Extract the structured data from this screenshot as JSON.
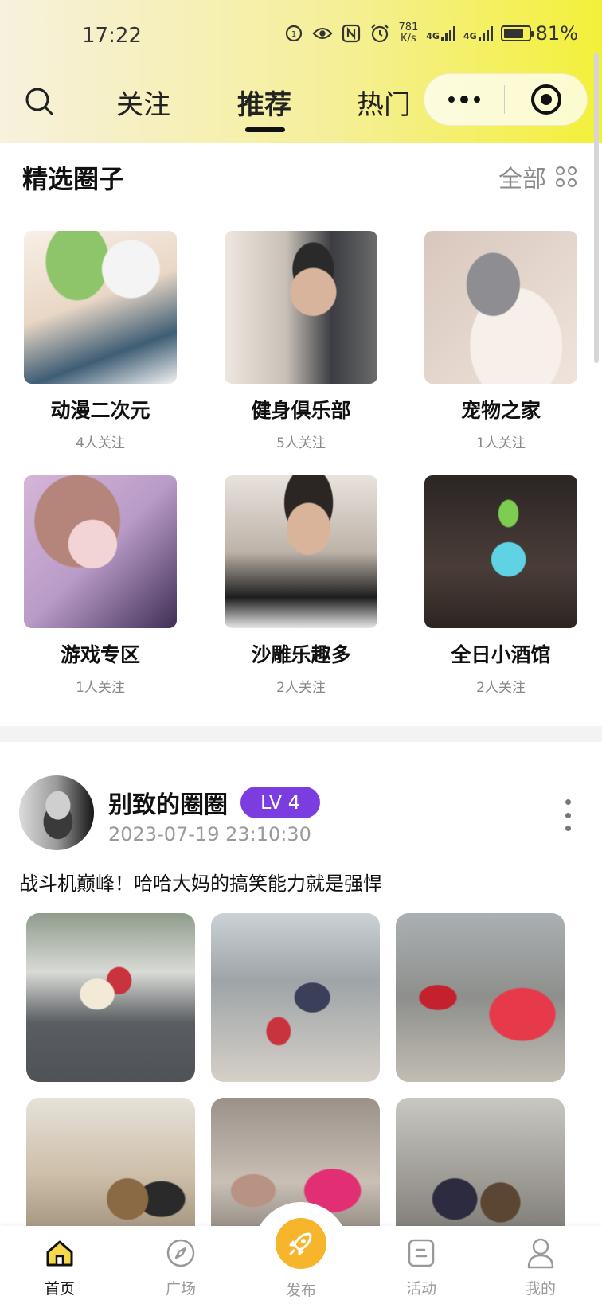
{
  "status_bar": {
    "time": "17:22",
    "speed_value": "781",
    "speed_unit": "K/s",
    "network1": "4G",
    "network2": "4G",
    "battery": "81%",
    "battery_level": 0.81
  },
  "nav": {
    "tabs": [
      {
        "label": "关注"
      },
      {
        "label": "推荐"
      },
      {
        "label": "热门"
      }
    ],
    "active_tab": "推荐"
  },
  "circles_section": {
    "title": "精选圈子",
    "see_all": "全部",
    "items": [
      {
        "name": "动漫二次元",
        "followers": "4人关注"
      },
      {
        "name": "健身俱乐部",
        "followers": "5人关注"
      },
      {
        "name": "宠物之家",
        "followers": "1人关注"
      },
      {
        "name": "游戏专区",
        "followers": "1人关注"
      },
      {
        "name": "沙雕乐趣多",
        "followers": "2人关注"
      },
      {
        "name": "全日小酒馆",
        "followers": "2人关注"
      }
    ]
  },
  "post": {
    "username": "别致的圈圈",
    "level": "LV 4",
    "timestamp": "2023-07-19 23:10:30",
    "content": "战斗机巅峰！哈哈大妈的搞笑能力就是强悍",
    "photo_count": 6
  },
  "tabbar": {
    "items": [
      {
        "label": "首页",
        "icon": "home-icon"
      },
      {
        "label": "广场",
        "icon": "compass-icon"
      },
      {
        "label": "发布",
        "icon": "rocket-icon"
      },
      {
        "label": "活动",
        "icon": "activity-icon"
      },
      {
        "label": "我的",
        "icon": "user-icon"
      }
    ],
    "active": "首页"
  },
  "colors": {
    "accent_yellow": "#f3f03a",
    "level_badge": "#7b3ddf",
    "publish_button": "#f6b52a"
  }
}
